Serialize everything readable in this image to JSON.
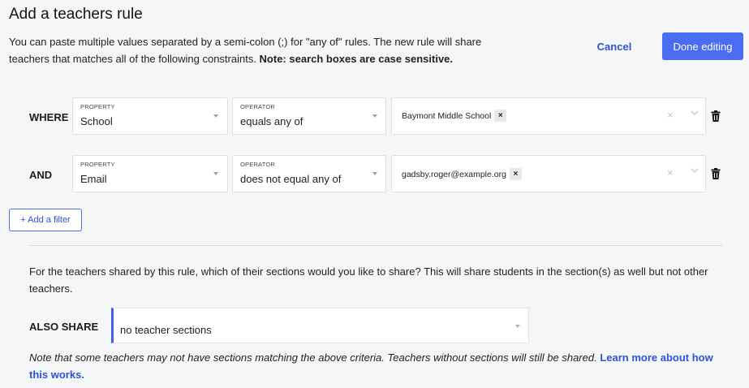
{
  "header": {
    "title": "Add a teachers rule",
    "description_line": "You can paste multiple values separated by a semi-colon (;) for \"any of\" rules. The new rule will share teachers that matches all of the following constraints. ",
    "description_bold": "Note: search boxes are case sensitive.",
    "cancel_label": "Cancel",
    "done_label": "Done editing"
  },
  "rules": [
    {
      "connector": "WHERE",
      "property_label": "PROPERTY",
      "property_value": "School",
      "operator_label": "OPERATOR",
      "operator_value": "equals any of",
      "values": [
        "Baymont Middle School"
      ]
    },
    {
      "connector": "AND",
      "property_label": "PROPERTY",
      "property_value": "Email",
      "operator_label": "OPERATOR",
      "operator_value": "does not equal any of",
      "values": [
        "gadsby.roger@example.org"
      ]
    }
  ],
  "add_filter_label": "+ Add a filter",
  "share": {
    "description": "For the teachers shared by this rule, which of their sections would you like to share? This will share students in the section(s) as well but not other teachers.",
    "label": "ALSO SHARE",
    "selected": "no teacher sections",
    "note": "Note that some teachers may not have sections matching the above criteria. Teachers without sections will still be shared. ",
    "learn_more": "Learn more about how this works."
  },
  "colors": {
    "accent": "#4a6cf0",
    "link": "#2c54d6",
    "background": "#f5f6f8"
  },
  "icons": {
    "chip_remove": "×",
    "clear": "×",
    "dropdown": "chevron-down-icon",
    "delete": "trash-icon"
  }
}
